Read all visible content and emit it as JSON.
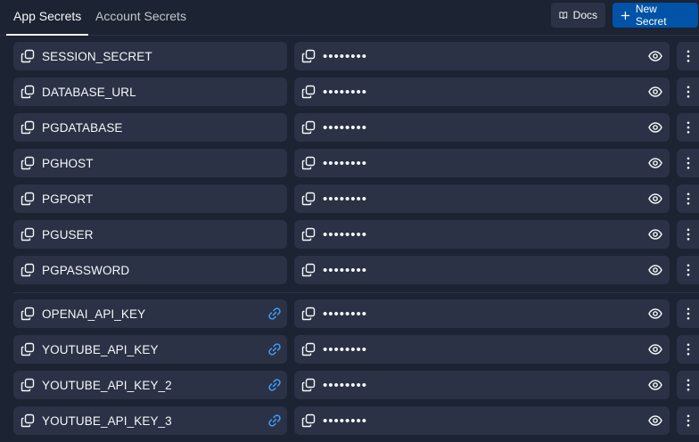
{
  "tabs": [
    {
      "label": "App Secrets",
      "active": true
    },
    {
      "label": "Account Secrets",
      "active": false
    }
  ],
  "toolbar": {
    "docs_label": "Docs",
    "docs_icon": "book-icon",
    "new_secret_label": "New Secret",
    "new_secret_icon": "plus-icon"
  },
  "colors": {
    "background": "#1c2333",
    "row": "#2b3245",
    "accent": "#0053a6",
    "link": "#3e9eff",
    "text": "#f5f9fc"
  },
  "secrets": [
    {
      "key": "SESSION_SECRET",
      "value_mask": "••••••••",
      "linked": false
    },
    {
      "key": "DATABASE_URL",
      "value_mask": "••••••••",
      "linked": false
    },
    {
      "key": "PGDATABASE",
      "value_mask": "••••••••",
      "linked": false
    },
    {
      "key": "PGHOST",
      "value_mask": "••••••••",
      "linked": false
    },
    {
      "key": "PGPORT",
      "value_mask": "••••••••",
      "linked": false
    },
    {
      "key": "PGUSER",
      "value_mask": "••••••••",
      "linked": false
    },
    {
      "key": "PGPASSWORD",
      "value_mask": "••••••••",
      "linked": false
    },
    {
      "key": "OPENAI_API_KEY",
      "value_mask": "••••••••",
      "linked": true
    },
    {
      "key": "YOUTUBE_API_KEY",
      "value_mask": "••••••••",
      "linked": true
    },
    {
      "key": "YOUTUBE_API_KEY_2",
      "value_mask": "••••••••",
      "linked": true
    },
    {
      "key": "YOUTUBE_API_KEY_3",
      "value_mask": "••••••••",
      "linked": true
    }
  ]
}
